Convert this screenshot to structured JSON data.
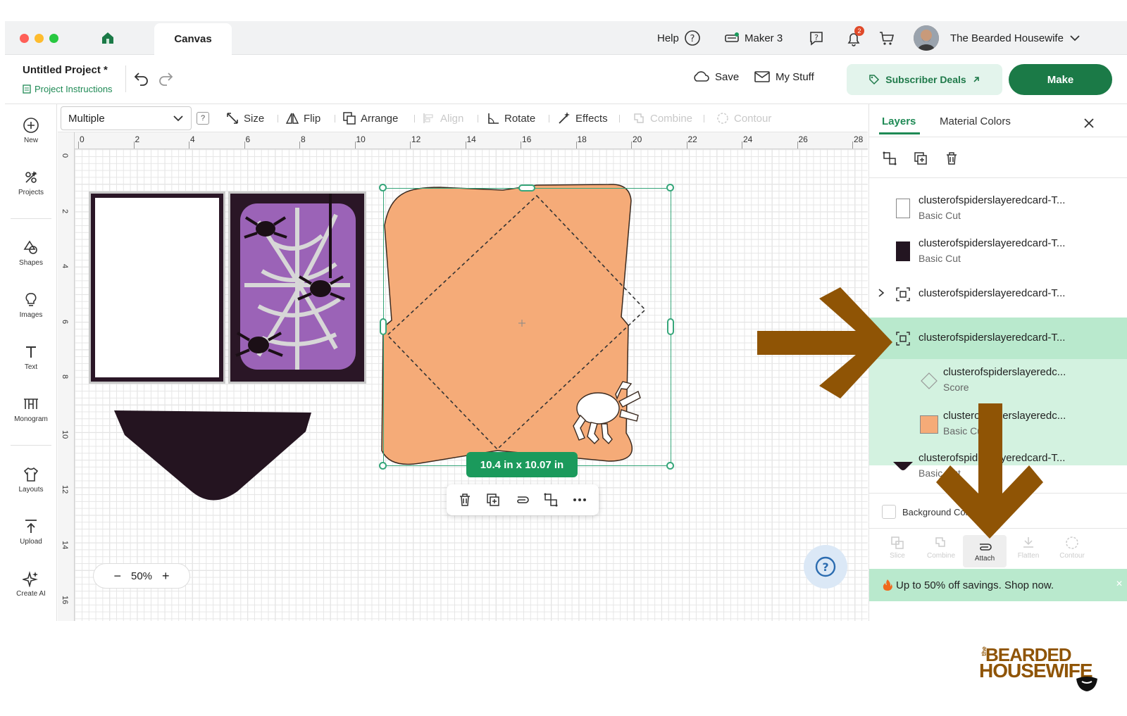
{
  "titlebar": {
    "tab_label": "Canvas",
    "help_label": "Help",
    "machine_label": "Maker 3",
    "notification_count": "2",
    "user_name": "The Bearded Housewife"
  },
  "project": {
    "name": "Untitled Project *",
    "instructions_label": "Project Instructions",
    "save_label": "Save",
    "mystuff_label": "My Stuff",
    "deals_label": "Subscriber Deals",
    "make_label": "Make"
  },
  "sidebar": {
    "items": [
      {
        "label": "New",
        "icon": "plus-circle-icon"
      },
      {
        "label": "Projects",
        "icon": "projects-icon"
      },
      {
        "label": "Shapes",
        "icon": "shapes-icon"
      },
      {
        "label": "Images",
        "icon": "lightbulb-icon"
      },
      {
        "label": "Text",
        "icon": "text-icon"
      },
      {
        "label": "Monogram",
        "icon": "monogram-icon"
      },
      {
        "label": "Layouts",
        "icon": "shirt-icon"
      },
      {
        "label": "Upload",
        "icon": "upload-icon"
      },
      {
        "label": "Create AI",
        "icon": "sparkle-icon"
      }
    ]
  },
  "edit_toolbar": {
    "select_value": "Multiple",
    "size_label": "Size",
    "flip_label": "Flip",
    "arrange_label": "Arrange",
    "align_label": "Align",
    "rotate_label": "Rotate",
    "effects_label": "Effects",
    "combine_label": "Combine",
    "contour_label": "Contour"
  },
  "ruler": {
    "top": [
      "0",
      "2",
      "4",
      "6",
      "8",
      "10",
      "12",
      "14",
      "16",
      "18",
      "20",
      "22",
      "24",
      "26",
      "28"
    ],
    "left": [
      "0",
      "2",
      "4",
      "6",
      "8",
      "10",
      "12",
      "14",
      "16"
    ]
  },
  "canvas": {
    "dimension_badge": "10.4  in x 10.07  in",
    "zoom_value": "50%"
  },
  "panel": {
    "tabs": [
      "Layers",
      "Material Colors"
    ],
    "layers": [
      {
        "name": "clusterofspiderslayeredcard-T...",
        "sub": "Basic Cut"
      },
      {
        "name": "clusterofspiderslayeredcard-T...",
        "sub": "Basic Cut"
      },
      {
        "name": "clusterofspiderslayeredcard-T...",
        "sub": ""
      },
      {
        "name": "clusterofspiderslayeredcard-T...",
        "sub": ""
      },
      {
        "name": "clusterofspiderslayeredc...",
        "sub": "Score"
      },
      {
        "name": "clusterofspiderslayeredc...",
        "sub": "Basic Cut"
      },
      {
        "name": "clusterofspiderslayeredcard-T...",
        "sub": "Basic Cut"
      }
    ],
    "background_label": "Background Color",
    "bottom_buttons": [
      "Slice",
      "Combine",
      "Attach",
      "Flatten",
      "Contour"
    ],
    "promo_text": "Up to 50% off savings. Shop now."
  },
  "watermark": {
    "small": "the",
    "line1": "BEARDED",
    "line2": "HOUSEWIFE"
  },
  "colors": {
    "make_green": "#1b7a47",
    "selected_layer": "#b9e9cd",
    "envelope": "#f5ab78",
    "arrow": "#8f5405"
  }
}
